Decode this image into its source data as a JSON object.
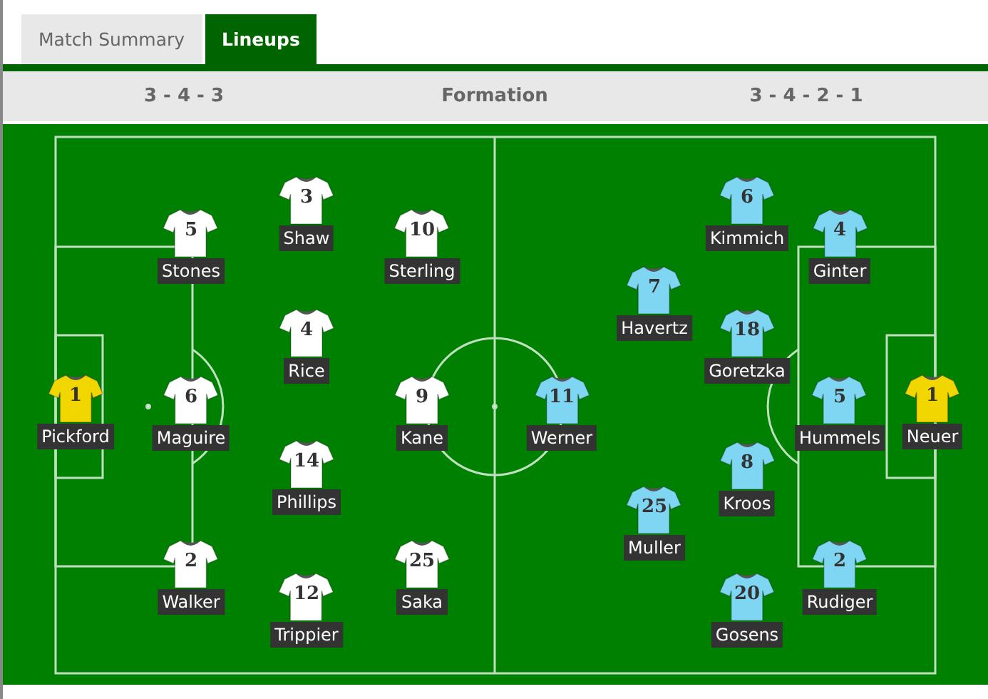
{
  "tabs": [
    {
      "label": "Match Summary",
      "selected": false
    },
    {
      "label": "Lineups",
      "selected": true
    }
  ],
  "formation_bar": {
    "home": "3 - 4 - 3",
    "label": "Formation",
    "away": "3 - 4 - 2 - 1"
  },
  "home_team": [
    {
      "number": "1",
      "name": "Pickford",
      "color": "#f2d600"
    },
    {
      "number": "5",
      "name": "Stones",
      "color": "#ffffff"
    },
    {
      "number": "6",
      "name": "Maguire",
      "color": "#ffffff"
    },
    {
      "number": "2",
      "name": "Walker",
      "color": "#ffffff"
    },
    {
      "number": "3",
      "name": "Shaw",
      "color": "#ffffff"
    },
    {
      "number": "4",
      "name": "Rice",
      "color": "#ffffff"
    },
    {
      "number": "14",
      "name": "Phillips",
      "color": "#ffffff"
    },
    {
      "number": "12",
      "name": "Trippier",
      "color": "#ffffff"
    },
    {
      "number": "10",
      "name": "Sterling",
      "color": "#ffffff"
    },
    {
      "number": "9",
      "name": "Kane",
      "color": "#ffffff"
    },
    {
      "number": "25",
      "name": "Saka",
      "color": "#ffffff"
    }
  ],
  "away_team": [
    {
      "number": "11",
      "name": "Werner",
      "color": "#7fd6f2"
    },
    {
      "number": "7",
      "name": "Havertz",
      "color": "#7fd6f2"
    },
    {
      "number": "25",
      "name": "Muller",
      "color": "#7fd6f2"
    },
    {
      "number": "6",
      "name": "Kimmich",
      "color": "#7fd6f2"
    },
    {
      "number": "18",
      "name": "Goretzka",
      "color": "#7fd6f2"
    },
    {
      "number": "8",
      "name": "Kroos",
      "color": "#7fd6f2"
    },
    {
      "number": "20",
      "name": "Gosens",
      "color": "#7fd6f2"
    },
    {
      "number": "4",
      "name": "Ginter",
      "color": "#7fd6f2"
    },
    {
      "number": "5",
      "name": "Hummels",
      "color": "#7fd6f2"
    },
    {
      "number": "2",
      "name": "Rudiger",
      "color": "#7fd6f2"
    },
    {
      "number": "1",
      "name": "Neuer",
      "color": "#f2d600"
    }
  ]
}
